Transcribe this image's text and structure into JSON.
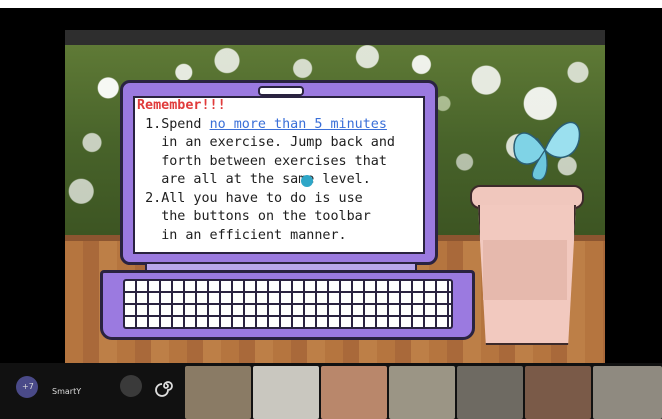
{
  "slide": {
    "title": "Remember!!!",
    "item1_num": "1.",
    "item1_lines": [
      "Spend ",
      "no more than 5 minutes",
      "in an exercise. Jump back and",
      "forth between exercises that",
      "are all at the same level."
    ],
    "item2_num": "2.",
    "item2_lines": [
      "All you have to do is use",
      "the buttons on the toolbar",
      "in an efficient manner."
    ]
  },
  "bottom_bar": {
    "participant_count": "+7",
    "app_label": "SmartY"
  },
  "colors": {
    "laptop": "#9b7ae0",
    "remember": "#e03b3b",
    "link": "#3a6fd8",
    "butterfly": "#7fd3e6",
    "cup": "#f2c9bf"
  },
  "icons": [
    "butterfly-icon",
    "spiral-icon"
  ]
}
